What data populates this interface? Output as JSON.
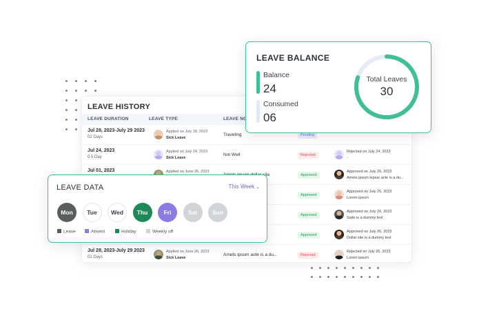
{
  "colors": {
    "accent_green": "#3fbf92",
    "balance_bar": "#3fbf92",
    "consumed_bar": "#e3e8f6",
    "leave": "#5a5d5e",
    "absent": "#8b7be3",
    "holiday": "#1f8a57",
    "weekly_off": "#d0d3d8"
  },
  "history": {
    "title": "LEAVE HISTORY",
    "columns": [
      "LEAVE DURATION",
      "LEAVE TYPE",
      "LEAVE NO"
    ],
    "rows": [
      {
        "duration": "Jul 28, 2023-July 29 2023",
        "days": "02 Days",
        "applied": "Applied on  July 28, 2023",
        "type": "Sick Leave",
        "note": "Traveling",
        "status": "Pending",
        "status_kind": "pending",
        "by_line1": "",
        "by_line2": "",
        "avatar": "av-a",
        "by_avatar": ""
      },
      {
        "duration": "Jul 24, 2023",
        "days": "0.5 Day",
        "applied": "Applied on  July 24, 2023",
        "type": "Sick Leave",
        "note": "Not Well",
        "status": "Rejected",
        "status_kind": "rejected",
        "by_line1": "Rejected on July 24, 2023",
        "by_line2": "-",
        "avatar": "av-b",
        "by_avatar": "av-b"
      },
      {
        "duration": "Jul 01, 2023",
        "days": "",
        "applied": "Applied on  June 26, 2023",
        "type": "",
        "note": "Amets ipsum dollar site",
        "status": "Approved",
        "status_kind": "approved",
        "by_line1": "Approved on July 26, 2023",
        "by_line2": "Amets ipsum lepsar acte is a du...",
        "avatar": "av-c",
        "by_avatar": "av-d"
      },
      {
        "duration": "",
        "days": "",
        "applied": "",
        "type": "",
        "note": "",
        "status": "Approved",
        "status_kind": "approved",
        "by_line1": "Approved on July 26, 2023",
        "by_line2": "Lorem ipsum",
        "avatar": "",
        "by_avatar": "av-e"
      },
      {
        "duration": "",
        "days": "",
        "applied": "",
        "type": "",
        "note": "",
        "status": "Approved",
        "status_kind": "approved",
        "by_line1": "Approved on July 26, 2023",
        "by_line2": "Saite is a dummy text",
        "avatar": "",
        "by_avatar": "av-f"
      },
      {
        "duration": "",
        "days": "",
        "applied": "",
        "type": "",
        "note": "",
        "status": "Approved",
        "status_kind": "approved",
        "by_line1": "Approved on July 26, 2023",
        "by_line2": "Dollar site is a dummy text",
        "avatar": "",
        "by_avatar": "av-d"
      },
      {
        "duration": "Jul 28, 2023-July 29 2023",
        "days": "02 Days",
        "applied": "Applied on  June 26, 2023",
        "type": "Sick Leave",
        "note": "Amets ipsum aote is a du...",
        "status": "Rejected",
        "status_kind": "rejected",
        "by_line1": "Rejected on July 26, 2023",
        "by_line2": "Lorem ipsum",
        "avatar": "av-c",
        "by_avatar": "av-g"
      }
    ]
  },
  "balance": {
    "title": "LEAVE BALANCE",
    "balance_label": "Balance",
    "balance_value": "24",
    "consumed_label": "Consumed",
    "consumed_value": "06",
    "total_label": "Total Leaves",
    "total_value": "30",
    "ring_fraction": 0.8
  },
  "leave_data": {
    "title": "LEAVE DATA",
    "period": "This Week",
    "days": [
      {
        "label": "Mon",
        "kind": "leave"
      },
      {
        "label": "Tue",
        "kind": "normal"
      },
      {
        "label": "Wed",
        "kind": "normal"
      },
      {
        "label": "Thu",
        "kind": "holiday"
      },
      {
        "label": "Fri",
        "kind": "absent"
      },
      {
        "label": "Sat",
        "kind": "weekly"
      },
      {
        "label": "Sun",
        "kind": "weekly"
      }
    ],
    "legend": [
      {
        "label": "Leave",
        "kind": "leave"
      },
      {
        "label": "Absent",
        "kind": "absent"
      },
      {
        "label": "Holiday",
        "kind": "holiday"
      },
      {
        "label": "Weekly off",
        "kind": "weekly"
      }
    ]
  }
}
